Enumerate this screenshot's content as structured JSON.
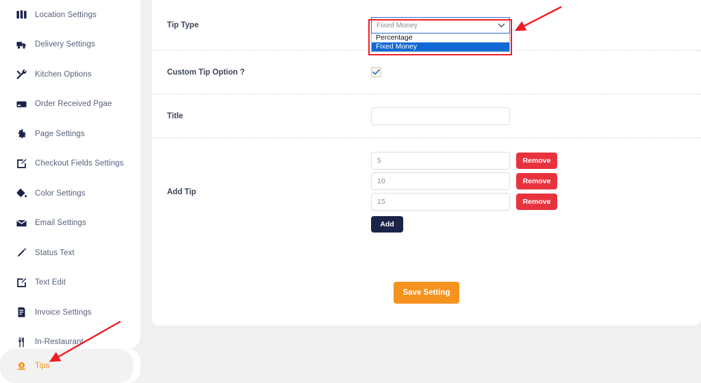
{
  "theme": {
    "page_bg": "#f0f0f0",
    "card_bg": "#ffffff",
    "accent_orange": "#f6921e",
    "navy": "#1b2448",
    "danger_red": "#e8333f",
    "select_highlight_blue": "#1169d6",
    "annotation_red": "#ee1c25"
  },
  "sidebar": {
    "items": [
      {
        "label": "Location Settings",
        "icon": "map-icon",
        "active": false
      },
      {
        "label": "Delivery Settings",
        "icon": "truck-icon",
        "active": false
      },
      {
        "label": "Kitchen Options",
        "icon": "tools-icon",
        "active": false
      },
      {
        "label": "Order Received Pgae",
        "icon": "card-icon",
        "active": false
      },
      {
        "label": "Page Settings",
        "icon": "gear-icon",
        "active": false
      },
      {
        "label": "Checkout Fields Settings",
        "icon": "pen-square-icon",
        "active": false
      },
      {
        "label": "Color Settings",
        "icon": "paint-drop-icon",
        "active": false
      },
      {
        "label": "Email Settings",
        "icon": "envelope-icon",
        "active": false
      },
      {
        "label": "Status Text",
        "icon": "pencil-icon",
        "active": false
      },
      {
        "label": "Text Edit",
        "icon": "pen-square-icon",
        "active": false
      },
      {
        "label": "Invoice Settings",
        "icon": "invoice-icon",
        "active": false
      },
      {
        "label": "In-Restaurant",
        "icon": "utensils-icon",
        "active": false
      }
    ],
    "active_item": {
      "label": "Tips",
      "icon": "coin-dollar-icon",
      "active": true
    }
  },
  "form": {
    "tip_type": {
      "label": "Tip Type",
      "selected_value": "Fixed Money",
      "options": [
        "Percentage",
        "Fixed Money"
      ],
      "expanded": true,
      "caret_icon": "chevron-down-icon"
    },
    "custom_tip_option": {
      "label": "Custom Tip Option ?",
      "checked": true,
      "check_icon": "checkmark-icon"
    },
    "title": {
      "label": "Title",
      "value": "",
      "placeholder": ""
    },
    "add_tip": {
      "label": "Add Tip",
      "rows": [
        {
          "value": "5",
          "remove_label": "Remove"
        },
        {
          "value": "10",
          "remove_label": "Remove"
        },
        {
          "value": "15",
          "remove_label": "Remove"
        }
      ],
      "add_label": "Add"
    },
    "save_label": "Save Setting"
  },
  "annotations": {
    "dropdown_arrow": "red-arrow-pointing-to-tip-type-dropdown",
    "dropdown_rect": "red-rectangle-around-tip-type-dropdown",
    "tips_arrow": "red-arrow-pointing-to-tips-sidebar-item"
  }
}
